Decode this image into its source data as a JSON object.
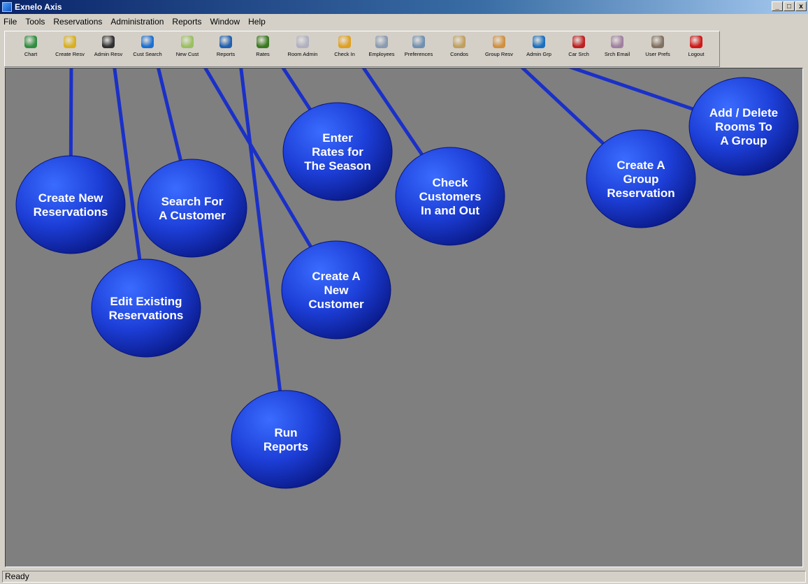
{
  "window": {
    "title": "Exnelo Axis",
    "controls": [
      "_",
      "□",
      "x"
    ]
  },
  "menu": [
    "File",
    "Tools",
    "Reservations",
    "Administration",
    "Reports",
    "Window",
    "Help"
  ],
  "toolbar": [
    {
      "label": "Chart",
      "icon": "chart-icon",
      "color": "#2f8f3f"
    },
    {
      "label": "Create Resv",
      "icon": "create-reservation-icon",
      "color": "#d8b020"
    },
    {
      "label": "Admin Resv",
      "icon": "admin-reservation-icon",
      "color": "#303030"
    },
    {
      "label": "Cust Search",
      "icon": "customer-search-icon",
      "color": "#1c6fd0"
    },
    {
      "label": "New Cust",
      "icon": "new-customer-icon",
      "color": "#9ac060"
    },
    {
      "label": "Reports",
      "icon": "reports-icon",
      "color": "#2060b0"
    },
    {
      "label": "Rates",
      "icon": "rates-icon",
      "color": "#3a7a20"
    },
    {
      "label": "Room Admin",
      "icon": "room-admin-icon",
      "color": "#b0b0c0"
    },
    {
      "label": "Check In",
      "icon": "check-in-icon",
      "color": "#e0a020"
    },
    {
      "label": "Employees",
      "icon": "employees-icon",
      "color": "#8a9ab0"
    },
    {
      "label": "Preferences",
      "icon": "preferences-icon",
      "color": "#7090b0"
    },
    {
      "label": "Condos",
      "icon": "condos-icon",
      "color": "#c0a060"
    },
    {
      "label": "Group Resv",
      "icon": "group-reservation-icon",
      "color": "#d09040"
    },
    {
      "label": "Admin Grp",
      "icon": "admin-group-icon",
      "color": "#1a70c0"
    },
    {
      "label": "Car Srch",
      "icon": "car-search-icon",
      "color": "#c02020"
    },
    {
      "label": "Srch Email",
      "icon": "search-email-icon",
      "color": "#a080a0"
    },
    {
      "label": "User Prefs",
      "icon": "user-prefs-icon",
      "color": "#807060"
    },
    {
      "label": "Logout",
      "icon": "logout-icon",
      "color": "#d01818"
    }
  ],
  "callouts": [
    {
      "lines": [
        "Create New",
        "Reservations"
      ],
      "points_to": "Create Resv"
    },
    {
      "lines": [
        "Edit Existing",
        "Reservations"
      ],
      "points_to": "Admin Resv"
    },
    {
      "lines": [
        "Search For",
        "A Customer"
      ],
      "points_to": "Cust Search"
    },
    {
      "lines": [
        "Create A",
        "New",
        "Customer"
      ],
      "points_to": "New Cust"
    },
    {
      "lines": [
        "Run",
        "Reports"
      ],
      "points_to": "Reports"
    },
    {
      "lines": [
        "Enter",
        "Rates for",
        "The Season"
      ],
      "points_to": "Rates"
    },
    {
      "lines": [
        "Check",
        "Customers",
        "In and Out"
      ],
      "points_to": "Check In"
    },
    {
      "lines": [
        "Create A",
        "Group",
        "Reservation"
      ],
      "points_to": "Group Resv"
    },
    {
      "lines": [
        "Add / Delete",
        "Rooms To",
        "A Group"
      ],
      "points_to": "Admin Grp"
    }
  ],
  "colors": {
    "callout_fill": "#1d3fd8",
    "callout_line": "#1a30c8",
    "workspace": "#7f7f7f"
  },
  "status": "Ready"
}
